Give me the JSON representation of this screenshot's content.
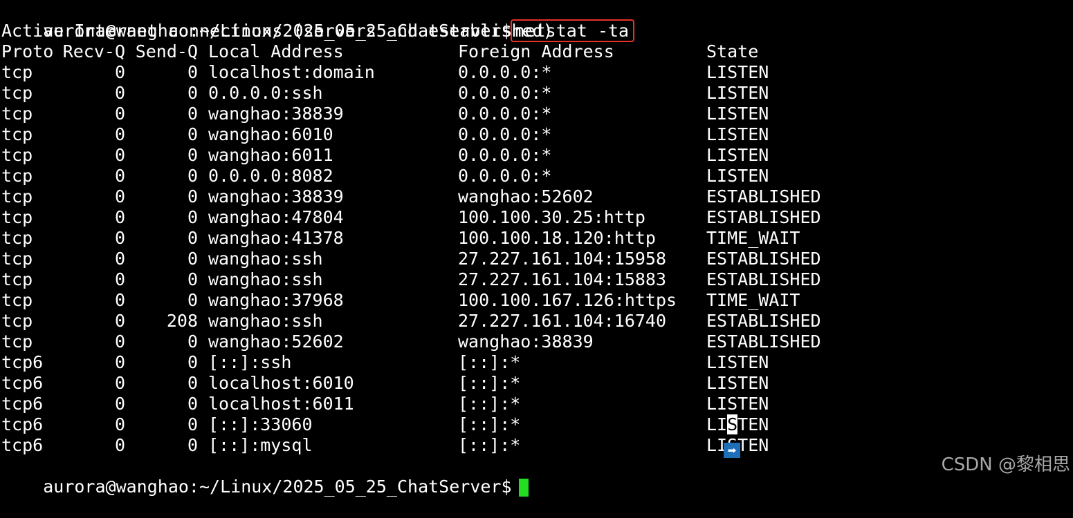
{
  "prompt": {
    "user_host_path": "aurora@wanghao:~/Linux/2025_05_25_ChatServer$",
    "command": "netstat -ta"
  },
  "output": {
    "header_line": "Active Internet connections (servers and established)",
    "columns": [
      "Proto",
      "Recv-Q",
      "Send-Q",
      "Local Address",
      "Foreign Address",
      "State"
    ],
    "rows": [
      [
        "tcp",
        "0",
        "0",
        "localhost:domain",
        "0.0.0.0:*",
        "LISTEN"
      ],
      [
        "tcp",
        "0",
        "0",
        "0.0.0.0:ssh",
        "0.0.0.0:*",
        "LISTEN"
      ],
      [
        "tcp",
        "0",
        "0",
        "wanghao:38839",
        "0.0.0.0:*",
        "LISTEN"
      ],
      [
        "tcp",
        "0",
        "0",
        "wanghao:6010",
        "0.0.0.0:*",
        "LISTEN"
      ],
      [
        "tcp",
        "0",
        "0",
        "wanghao:6011",
        "0.0.0.0:*",
        "LISTEN"
      ],
      [
        "tcp",
        "0",
        "0",
        "0.0.0.0:8082",
        "0.0.0.0:*",
        "LISTEN"
      ],
      [
        "tcp",
        "0",
        "0",
        "wanghao:38839",
        "wanghao:52602",
        "ESTABLISHED"
      ],
      [
        "tcp",
        "0",
        "0",
        "wanghao:47804",
        "100.100.30.25:http",
        "ESTABLISHED"
      ],
      [
        "tcp",
        "0",
        "0",
        "wanghao:41378",
        "100.100.18.120:http",
        "TIME_WAIT"
      ],
      [
        "tcp",
        "0",
        "0",
        "wanghao:ssh",
        "27.227.161.104:15958",
        "ESTABLISHED"
      ],
      [
        "tcp",
        "0",
        "0",
        "wanghao:ssh",
        "27.227.161.104:15883",
        "ESTABLISHED"
      ],
      [
        "tcp",
        "0",
        "0",
        "wanghao:37968",
        "100.100.167.126:https",
        "TIME_WAIT"
      ],
      [
        "tcp",
        "0",
        "208",
        "wanghao:ssh",
        "27.227.161.104:16740",
        "ESTABLISHED"
      ],
      [
        "tcp",
        "0",
        "0",
        "wanghao:52602",
        "wanghao:38839",
        "ESTABLISHED"
      ],
      [
        "tcp6",
        "0",
        "0",
        "[::]:ssh",
        "[::]:*",
        "LISTEN"
      ],
      [
        "tcp6",
        "0",
        "0",
        "localhost:6010",
        "[::]:*",
        "LISTEN"
      ],
      [
        "tcp6",
        "0",
        "0",
        "localhost:6011",
        "[::]:*",
        "LISTEN"
      ],
      [
        "tcp6",
        "0",
        "0",
        "[::]:33060",
        "[::]:*",
        "LISTEN"
      ],
      [
        "tcp6",
        "0",
        "0",
        "[::]:mysql",
        "[::]:*",
        "LISTEN"
      ]
    ]
  },
  "selection": {
    "row": 17,
    "state_before": "LI",
    "state_char": "S",
    "state_after": "TEN"
  },
  "scroll_marker_glyph": "➡",
  "watermark": "CSDN @黎相思",
  "colors": {
    "background": "#000000",
    "text": "#ffffff",
    "command_highlight_border": "#e8322c",
    "cursor": "#22dd22",
    "scroll_marker": "#1e6fb8"
  }
}
